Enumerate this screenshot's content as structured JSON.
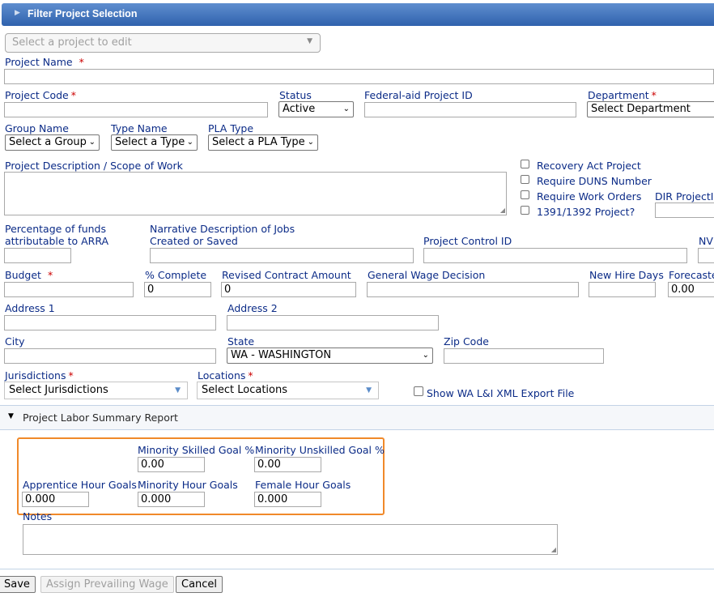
{
  "header": {
    "title": "Filter Project Selection"
  },
  "project_select": {
    "placeholder": "Select a project to edit"
  },
  "fields": {
    "project_name": "Project Name",
    "project_code": "Project Code",
    "status": "Status",
    "status_value": "Active",
    "federal_aid_id": "Federal-aid Project ID",
    "department": "Department",
    "department_value": "Select Department",
    "group_name": "Group Name",
    "group_value": "Select a Group",
    "type_name": "Type Name",
    "type_value": "Select a Type",
    "pla_type": "PLA Type",
    "pla_value": "Select a PLA Type",
    "description": "Project Description / Scope of Work",
    "pct_funds_line1": "Percentage of funds",
    "pct_funds_line2": "attributable to ARRA",
    "narrative_line1": "Narrative Description of Jobs",
    "narrative_line2": "Created or Saved",
    "control_id": "Project Control ID",
    "nv": "NV",
    "dir_project": "DIR ProjectID",
    "budget": "Budget",
    "pct_complete": "% Complete",
    "pct_complete_value": "0",
    "revised_amount": "Revised Contract Amount",
    "revised_amount_value": "0",
    "general_wage": "General Wage Decision",
    "new_hire_days": "New Hire Days",
    "forecasted": "Forecaste",
    "forecasted_value": "0.00",
    "address1": "Address 1",
    "address2": "Address 2",
    "city": "City",
    "state": "State",
    "state_value": "WA - WASHINGTON",
    "zip": "Zip Code",
    "jurisdictions": "Jurisdictions",
    "jurisdictions_value": "Select Jurisdictions",
    "locations": "Locations",
    "locations_value": "Select Locations",
    "xml_export": "Show WA L&I XML Export File",
    "required_mark": "*"
  },
  "checkboxes": [
    {
      "label": "Recovery Act Project"
    },
    {
      "label": "Require DUNS Number"
    },
    {
      "label": "Require Work Orders"
    },
    {
      "label": "1391/1392 Project?"
    }
  ],
  "labor_report": {
    "title": "Project Labor Summary Report",
    "minority_skilled": "Minority Skilled Goal %",
    "minority_skilled_value": "0.00",
    "minority_unskilled": "Minority Unskilled Goal %",
    "minority_unskilled_value": "0.00",
    "apprentice_hours": "Apprentice Hour Goals",
    "apprentice_hours_value": "0.000",
    "minority_hours": "Minority Hour Goals",
    "minority_hours_value": "0.000",
    "female_hours": "Female Hour Goals",
    "female_hours_value": "0.000",
    "notes": "Notes"
  },
  "buttons": {
    "save": "Save",
    "assign": "Assign Prevailing Wage",
    "cancel": "Cancel"
  },
  "colors": {
    "highlight": "#f0892a",
    "header_top": "#5f8ecf",
    "header_bottom": "#2f62ad",
    "label": "#0b2b87"
  }
}
